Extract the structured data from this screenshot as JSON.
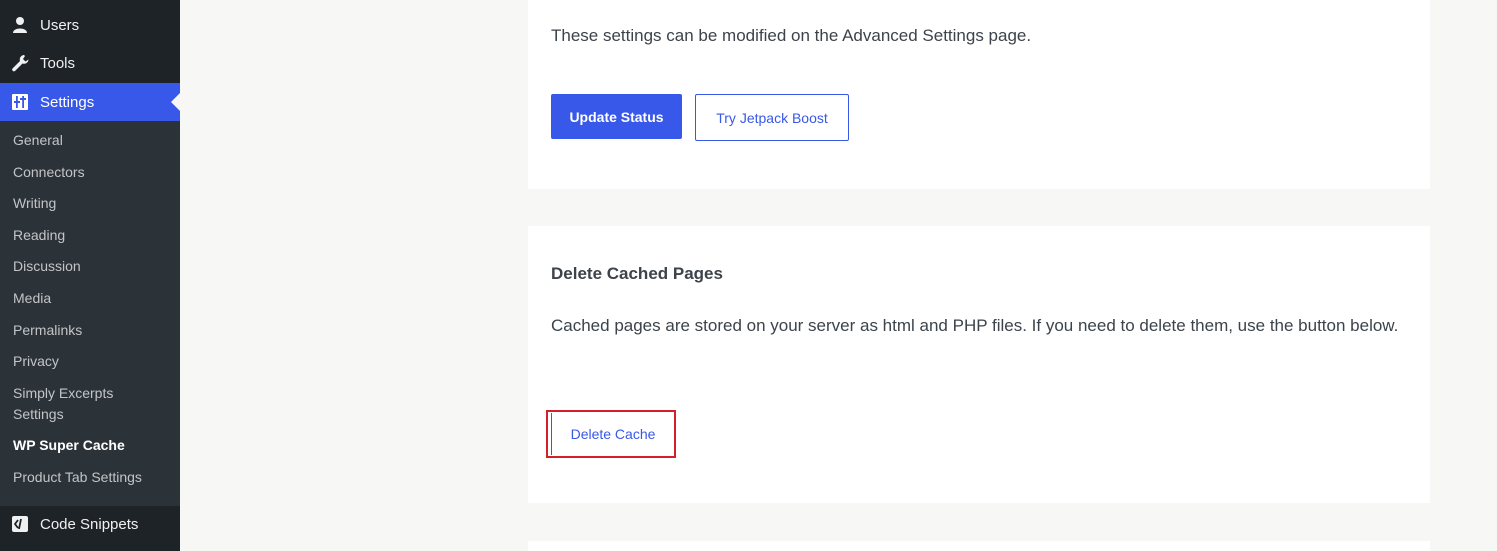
{
  "sidebar": {
    "top_items": [
      {
        "label": "Users",
        "icon": "users-icon"
      },
      {
        "label": "Tools",
        "icon": "wrench-icon"
      },
      {
        "label": "Settings",
        "icon": "settings-icon"
      }
    ],
    "settings_submenu": [
      "General",
      "Connectors",
      "Writing",
      "Reading",
      "Discussion",
      "Media",
      "Permalinks",
      "Privacy",
      "Simply Excerpts Settings",
      "WP Super Cache",
      "Product Tab Settings"
    ],
    "bottom_item": {
      "label": "Code Snippets",
      "icon": "code-snippets-icon"
    },
    "accent_color": "#3858e9"
  },
  "status_card": {
    "description": "These settings can be modified on the Advanced Settings page.",
    "update_button": "Update Status",
    "jetpack_button": "Try Jetpack Boost"
  },
  "delete_card": {
    "heading": "Delete Cached Pages",
    "description": "Cached pages are stored on your server as html and PHP files. If you need to delete them, use the button below.",
    "delete_button": "Delete Cache",
    "highlight_color": "#d31f28"
  }
}
